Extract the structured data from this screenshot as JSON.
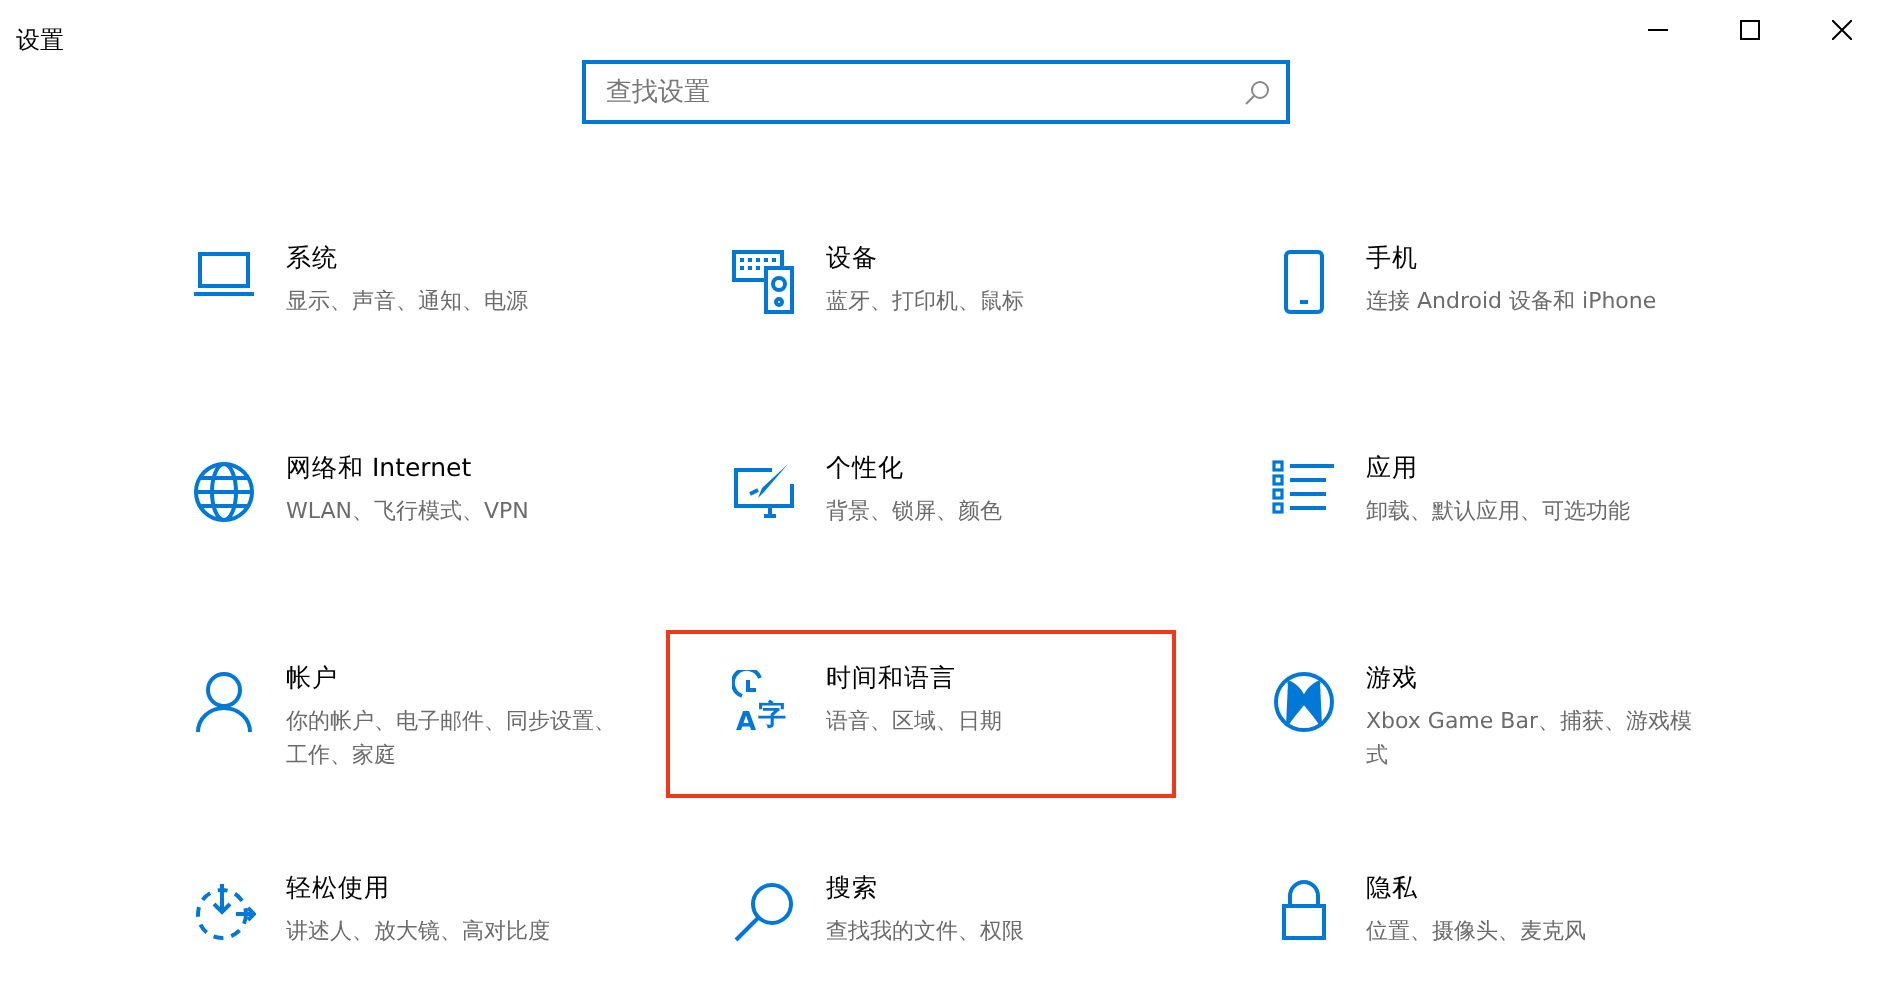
{
  "window": {
    "title": "设置"
  },
  "search": {
    "placeholder": "查找设置"
  },
  "tiles": [
    {
      "kind": "laptop",
      "title": "系统",
      "description": "显示、声音、通知、电源",
      "selected": false
    },
    {
      "kind": "keyboard",
      "title": "设备",
      "description": "蓝牙、打印机、鼠标",
      "selected": false
    },
    {
      "kind": "phone",
      "title": "手机",
      "description": "连接 Android 设备和 iPhone",
      "selected": false
    },
    {
      "kind": "globe",
      "title": "网络和 Internet",
      "description": "WLAN、飞行模式、VPN",
      "selected": false
    },
    {
      "kind": "paint",
      "title": "个性化",
      "description": "背景、锁屏、颜色",
      "selected": false
    },
    {
      "kind": "list",
      "title": "应用",
      "description": "卸载、默认应用、可选功能",
      "selected": false
    },
    {
      "kind": "person",
      "title": "帐户",
      "description": "你的帐户、电子邮件、同步设置、工作、家庭",
      "selected": false
    },
    {
      "kind": "language",
      "icon_letters": [
        "A",
        "字"
      ],
      "title": "时间和语言",
      "description": "语音、区域、日期",
      "selected": true
    },
    {
      "kind": "xbox",
      "title": "游戏",
      "description": "Xbox Game Bar、捕获、游戏模式",
      "selected": false
    },
    {
      "kind": "ease",
      "title": "轻松使用",
      "description": "讲述人、放大镜、高对比度",
      "selected": false
    },
    {
      "kind": "search",
      "title": "搜索",
      "description": "查找我的文件、权限",
      "selected": false
    },
    {
      "kind": "lock",
      "title": "隐私",
      "description": "位置、摄像头、麦克风",
      "selected": false
    }
  ]
}
